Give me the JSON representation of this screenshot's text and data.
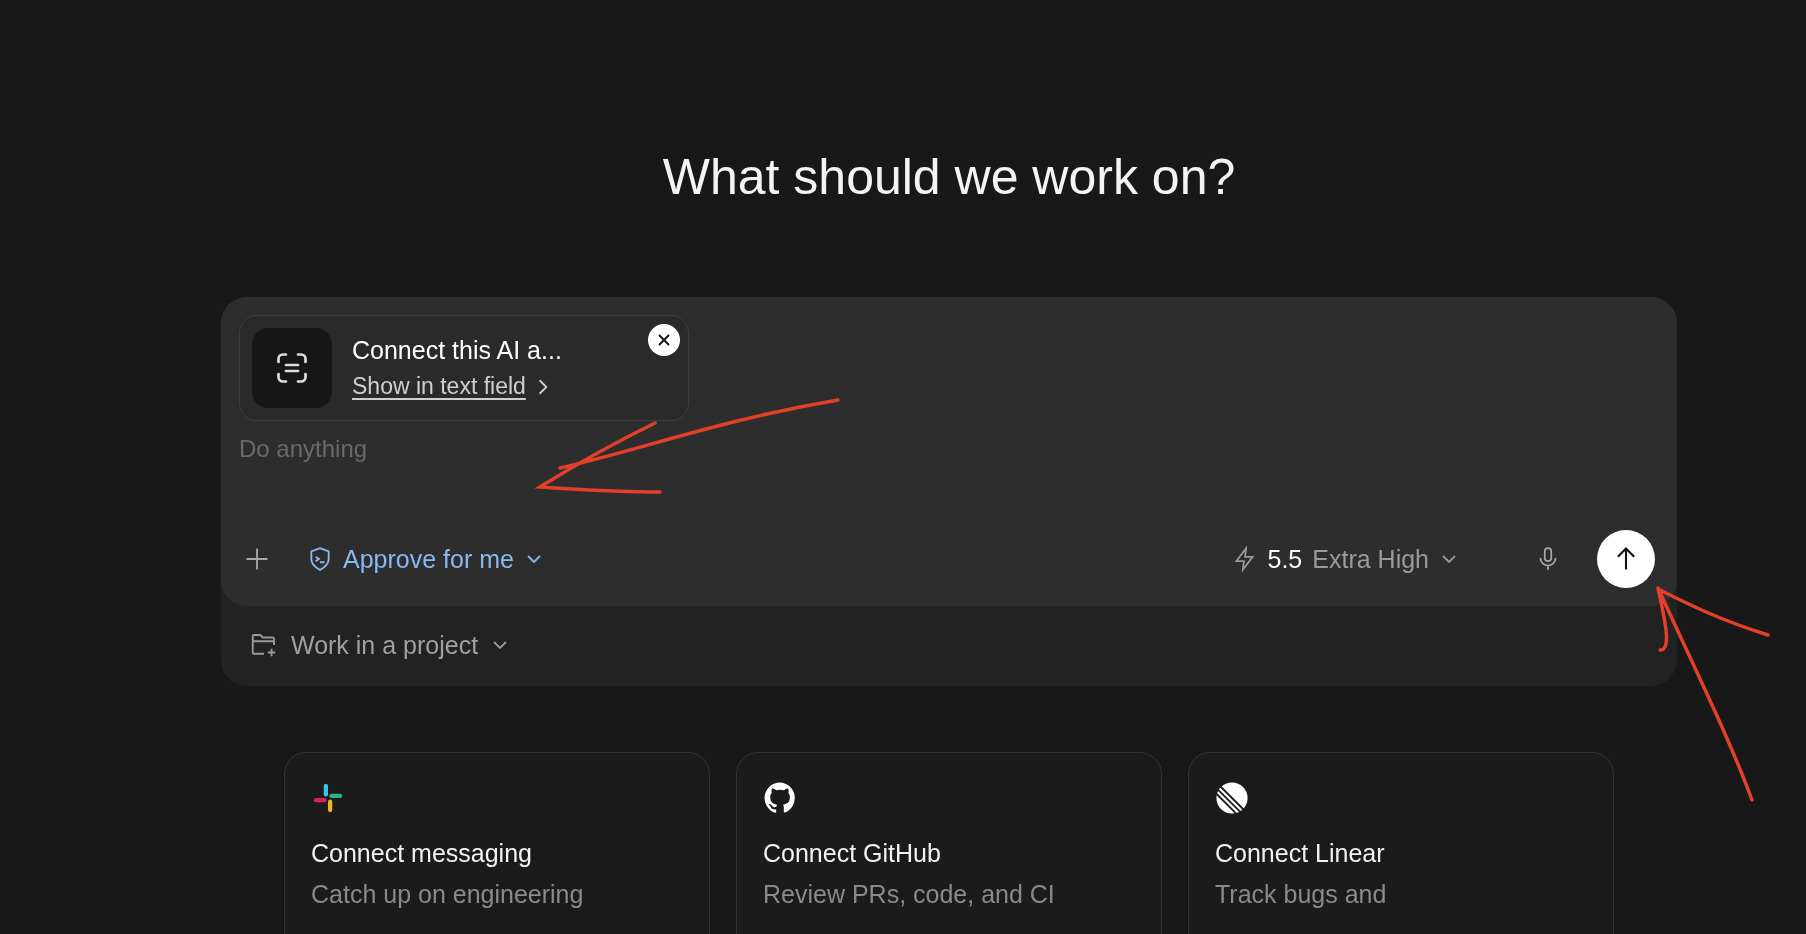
{
  "heading": "What should we work on?",
  "composer": {
    "suggestion": {
      "title": "Connect this AI a...",
      "link": "Show in text field"
    },
    "placeholder": "Do anything",
    "approval": "Approve for me",
    "model": {
      "version": "5.5",
      "effort": "Extra High"
    }
  },
  "project": "Work in a project",
  "cards": [
    {
      "kind": "slack",
      "title": "Connect messaging",
      "description": "Catch up on engineering"
    },
    {
      "kind": "github",
      "title": "Connect GitHub",
      "description": "Review PRs, code, and CI"
    },
    {
      "kind": "linear",
      "title": "Connect Linear",
      "description": "Track bugs and"
    }
  ],
  "annotations": [
    {
      "kind": "arrow"
    },
    {
      "kind": "arrow"
    }
  ]
}
